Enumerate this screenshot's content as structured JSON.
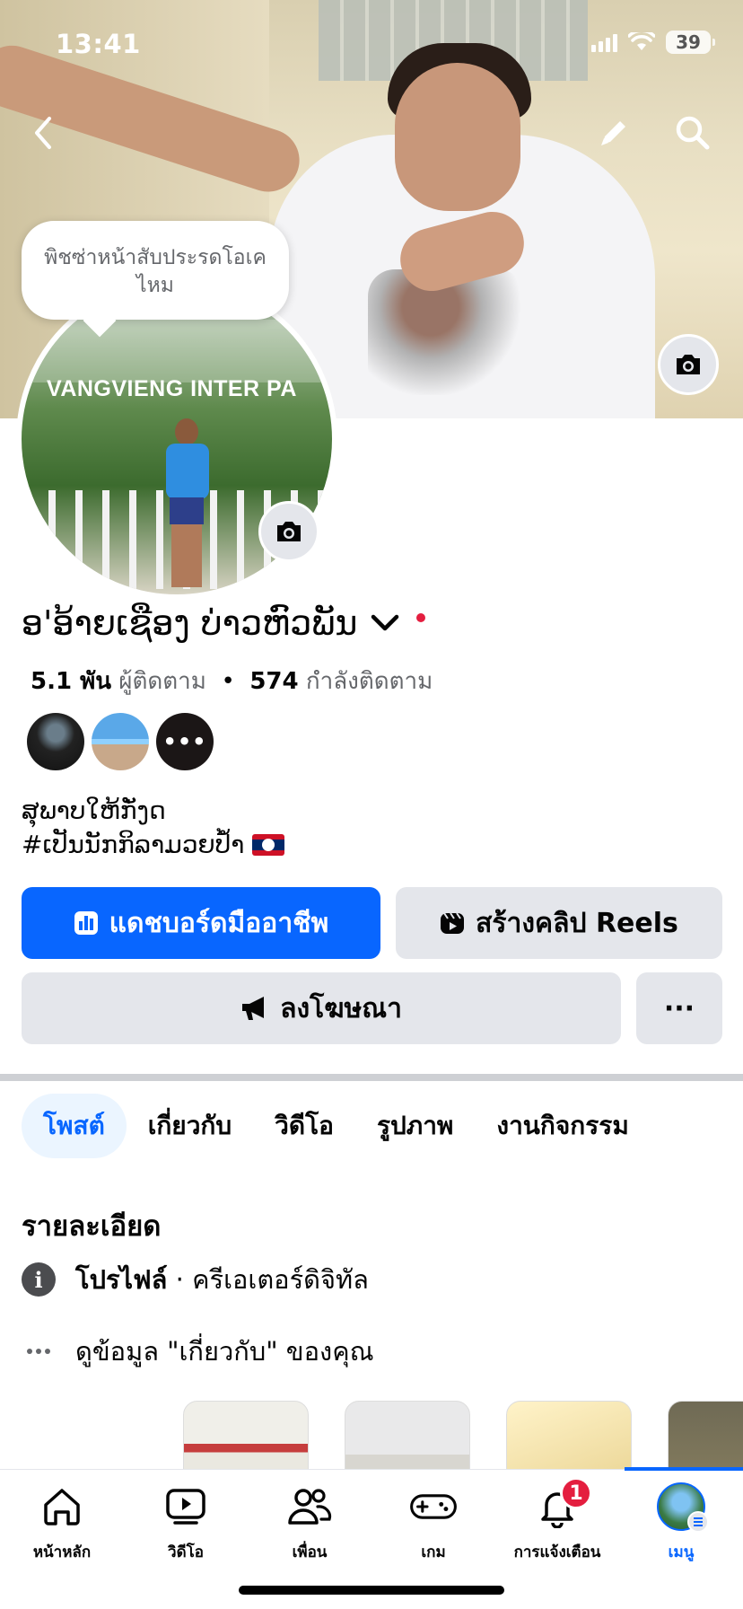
{
  "status_bar": {
    "time": "13:41",
    "battery": "39"
  },
  "profile": {
    "tooltip": "พิชซ่าหน้าสับประรดโอเคไหม",
    "avatar_sign_text": "VANGVIENG INTER PA",
    "name": "ອ'ອ້າຍເຊືອງ ບ່າວຫົວພັນ",
    "followers_count": "5.1 พัน",
    "followers_label": "ผู้ติดตาม",
    "separator": "•",
    "following_count": "574",
    "following_label": "กำลังติดตาม",
    "friends_more": "•••",
    "bio_line1": "ສຸພາບໃຫ້ກັ່ງດ",
    "bio_line2": "#ເປັນນັກກິລາມວຍປ້ຳ"
  },
  "actions": {
    "dashboard": "แดชบอร์ดมืออาชีพ",
    "reels": "สร้างคลิป Reels",
    "ads": "ลงโฆษณา",
    "more": "···"
  },
  "tabs": [
    "โพสต์",
    "เกี่ยวกับ",
    "วิดีโอ",
    "รูปภาพ",
    "งานกิจกรรม"
  ],
  "details": {
    "title": "รายละเอียด",
    "profile_bold": "โปรไฟล์",
    "profile_rest": " · ครีเอเตอร์ดิจิทัล",
    "about_link": "ดูข้อมูล \"เกี่ยวกับ\" ของคุณ"
  },
  "bottom_nav": {
    "home": "หน้าหลัก",
    "video": "วิดีโอ",
    "friends": "เพื่อน",
    "gaming": "เกม",
    "notifications": "การแจ้งเตือน",
    "notifications_badge": "1",
    "menu": "เมนู"
  },
  "colors": {
    "accent": "#0866ff",
    "badge": "#e41e3f",
    "button_gray": "#e4e6eb"
  }
}
